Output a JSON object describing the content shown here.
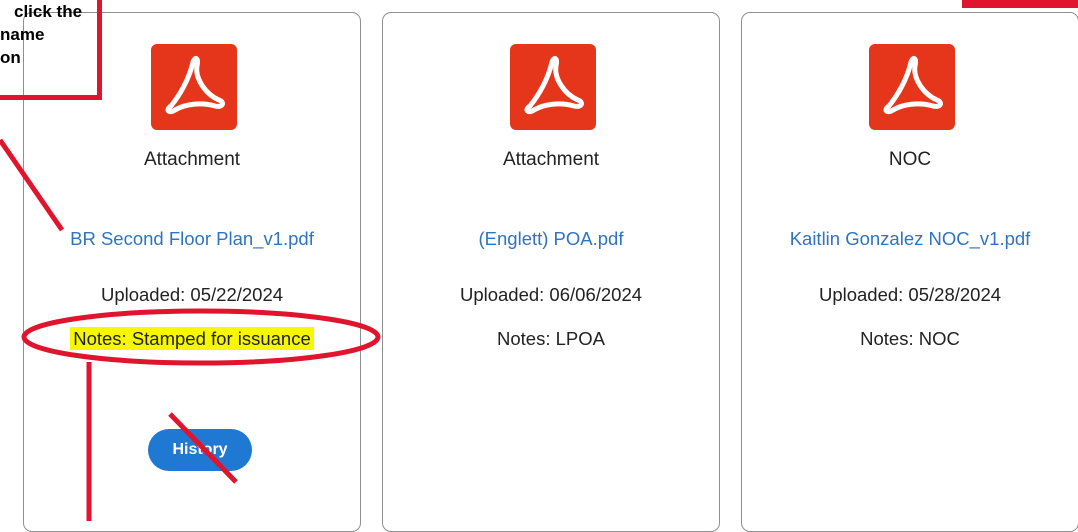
{
  "annotation": {
    "callout_lines": [
      "click the",
      "name",
      "on"
    ]
  },
  "cards": [
    {
      "icon": "acrobat-pdf-icon",
      "doc_type": "Attachment",
      "file_name": "BR Second Floor Plan_v1.pdf",
      "uploaded": "Uploaded: 05/22/2024",
      "notes": "Notes: Stamped for issuance",
      "history_label": "History"
    },
    {
      "icon": "acrobat-pdf-icon",
      "doc_type": "Attachment",
      "file_name": "(Englett) POA.pdf",
      "uploaded": "Uploaded: 06/06/2024",
      "notes": "Notes: LPOA"
    },
    {
      "icon": "acrobat-pdf-icon",
      "doc_type": "NOC",
      "file_name": "Kaitlin Gonzalez NOC_v1.pdf",
      "uploaded": "Uploaded: 05/28/2024",
      "notes": "Notes: NOC"
    }
  ],
  "colors": {
    "pdf_red": "#e5361b",
    "link_blue": "#2e74c3",
    "button_blue": "#1f78d1",
    "annotation_red": "#e0142c",
    "highlight_yellow": "#f7f700"
  }
}
